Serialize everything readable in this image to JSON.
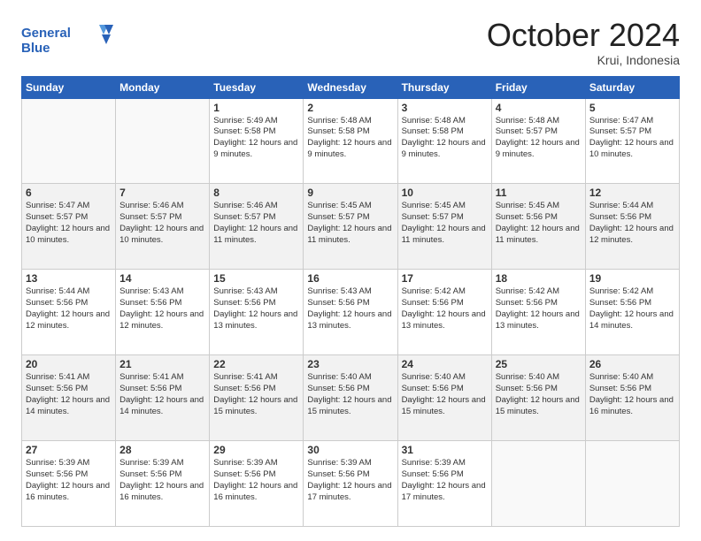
{
  "header": {
    "logo_line1": "General",
    "logo_line2": "Blue",
    "month": "October 2024",
    "location": "Krui, Indonesia"
  },
  "days_of_week": [
    "Sunday",
    "Monday",
    "Tuesday",
    "Wednesday",
    "Thursday",
    "Friday",
    "Saturday"
  ],
  "weeks": [
    [
      {
        "day": "",
        "info": ""
      },
      {
        "day": "",
        "info": ""
      },
      {
        "day": "1",
        "info": "Sunrise: 5:49 AM\nSunset: 5:58 PM\nDaylight: 12 hours and 9 minutes."
      },
      {
        "day": "2",
        "info": "Sunrise: 5:48 AM\nSunset: 5:58 PM\nDaylight: 12 hours and 9 minutes."
      },
      {
        "day": "3",
        "info": "Sunrise: 5:48 AM\nSunset: 5:58 PM\nDaylight: 12 hours and 9 minutes."
      },
      {
        "day": "4",
        "info": "Sunrise: 5:48 AM\nSunset: 5:57 PM\nDaylight: 12 hours and 9 minutes."
      },
      {
        "day": "5",
        "info": "Sunrise: 5:47 AM\nSunset: 5:57 PM\nDaylight: 12 hours and 10 minutes."
      }
    ],
    [
      {
        "day": "6",
        "info": "Sunrise: 5:47 AM\nSunset: 5:57 PM\nDaylight: 12 hours and 10 minutes."
      },
      {
        "day": "7",
        "info": "Sunrise: 5:46 AM\nSunset: 5:57 PM\nDaylight: 12 hours and 10 minutes."
      },
      {
        "day": "8",
        "info": "Sunrise: 5:46 AM\nSunset: 5:57 PM\nDaylight: 12 hours and 11 minutes."
      },
      {
        "day": "9",
        "info": "Sunrise: 5:45 AM\nSunset: 5:57 PM\nDaylight: 12 hours and 11 minutes."
      },
      {
        "day": "10",
        "info": "Sunrise: 5:45 AM\nSunset: 5:57 PM\nDaylight: 12 hours and 11 minutes."
      },
      {
        "day": "11",
        "info": "Sunrise: 5:45 AM\nSunset: 5:56 PM\nDaylight: 12 hours and 11 minutes."
      },
      {
        "day": "12",
        "info": "Sunrise: 5:44 AM\nSunset: 5:56 PM\nDaylight: 12 hours and 12 minutes."
      }
    ],
    [
      {
        "day": "13",
        "info": "Sunrise: 5:44 AM\nSunset: 5:56 PM\nDaylight: 12 hours and 12 minutes."
      },
      {
        "day": "14",
        "info": "Sunrise: 5:43 AM\nSunset: 5:56 PM\nDaylight: 12 hours and 12 minutes."
      },
      {
        "day": "15",
        "info": "Sunrise: 5:43 AM\nSunset: 5:56 PM\nDaylight: 12 hours and 13 minutes."
      },
      {
        "day": "16",
        "info": "Sunrise: 5:43 AM\nSunset: 5:56 PM\nDaylight: 12 hours and 13 minutes."
      },
      {
        "day": "17",
        "info": "Sunrise: 5:42 AM\nSunset: 5:56 PM\nDaylight: 12 hours and 13 minutes."
      },
      {
        "day": "18",
        "info": "Sunrise: 5:42 AM\nSunset: 5:56 PM\nDaylight: 12 hours and 13 minutes."
      },
      {
        "day": "19",
        "info": "Sunrise: 5:42 AM\nSunset: 5:56 PM\nDaylight: 12 hours and 14 minutes."
      }
    ],
    [
      {
        "day": "20",
        "info": "Sunrise: 5:41 AM\nSunset: 5:56 PM\nDaylight: 12 hours and 14 minutes."
      },
      {
        "day": "21",
        "info": "Sunrise: 5:41 AM\nSunset: 5:56 PM\nDaylight: 12 hours and 14 minutes."
      },
      {
        "day": "22",
        "info": "Sunrise: 5:41 AM\nSunset: 5:56 PM\nDaylight: 12 hours and 15 minutes."
      },
      {
        "day": "23",
        "info": "Sunrise: 5:40 AM\nSunset: 5:56 PM\nDaylight: 12 hours and 15 minutes."
      },
      {
        "day": "24",
        "info": "Sunrise: 5:40 AM\nSunset: 5:56 PM\nDaylight: 12 hours and 15 minutes."
      },
      {
        "day": "25",
        "info": "Sunrise: 5:40 AM\nSunset: 5:56 PM\nDaylight: 12 hours and 15 minutes."
      },
      {
        "day": "26",
        "info": "Sunrise: 5:40 AM\nSunset: 5:56 PM\nDaylight: 12 hours and 16 minutes."
      }
    ],
    [
      {
        "day": "27",
        "info": "Sunrise: 5:39 AM\nSunset: 5:56 PM\nDaylight: 12 hours and 16 minutes."
      },
      {
        "day": "28",
        "info": "Sunrise: 5:39 AM\nSunset: 5:56 PM\nDaylight: 12 hours and 16 minutes."
      },
      {
        "day": "29",
        "info": "Sunrise: 5:39 AM\nSunset: 5:56 PM\nDaylight: 12 hours and 16 minutes."
      },
      {
        "day": "30",
        "info": "Sunrise: 5:39 AM\nSunset: 5:56 PM\nDaylight: 12 hours and 17 minutes."
      },
      {
        "day": "31",
        "info": "Sunrise: 5:39 AM\nSunset: 5:56 PM\nDaylight: 12 hours and 17 minutes."
      },
      {
        "day": "",
        "info": ""
      },
      {
        "day": "",
        "info": ""
      }
    ]
  ]
}
